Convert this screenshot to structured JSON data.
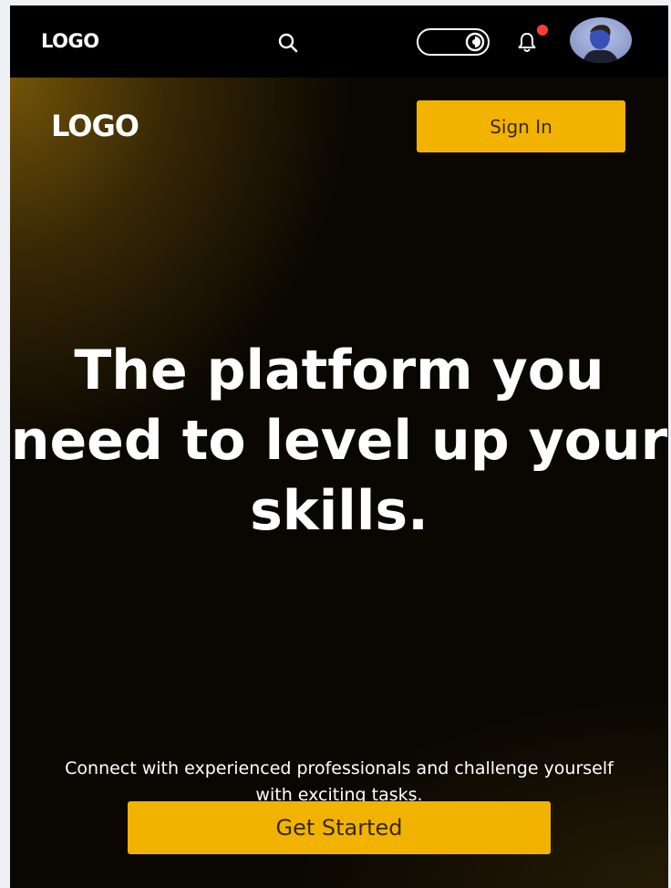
{
  "topbar": {
    "logo": "LOGO",
    "search_icon": "search-icon",
    "theme_toggle_icon": "theme-toggle-icon",
    "bell_icon": "bell-icon",
    "notification_dot_color": "#ff3b3b",
    "avatar": "user-avatar"
  },
  "hero": {
    "logo": "LOGO",
    "sign_in_label": "Sign In",
    "headline": "The platform you need to level up your skills.",
    "subtext": "Connect with experienced professionals and challenge yourself with exciting tasks.",
    "cta_label": "Get Started"
  },
  "colors": {
    "accent": "#f2b300",
    "background": "#000000",
    "text": "#ffffff"
  }
}
